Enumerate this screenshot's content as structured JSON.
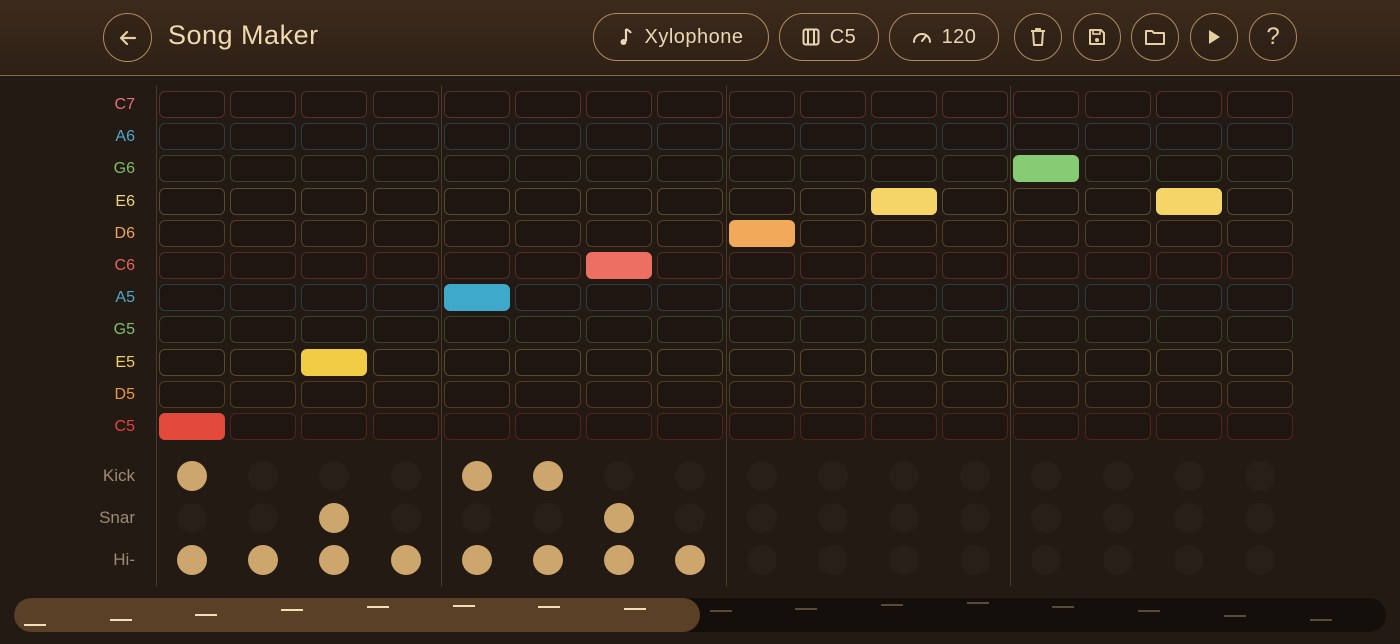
{
  "app": {
    "title": "Song Maker"
  },
  "toolbar": {
    "instrument": "Xylophone",
    "key": "C5",
    "tempo": "120",
    "icons": [
      "back-icon",
      "music-note-icon",
      "piano-icon",
      "speedometer-icon",
      "trash-icon",
      "save-icon",
      "folder-icon",
      "play-icon",
      "help-icon"
    ]
  },
  "rows": [
    {
      "label": "C7",
      "color": "#e7707e"
    },
    {
      "label": "A6",
      "color": "#4fa6c8"
    },
    {
      "label": "G6",
      "color": "#7cbf6a"
    },
    {
      "label": "E6",
      "color": "#efd47a"
    },
    {
      "label": "D6",
      "color": "#e9a55a"
    },
    {
      "label": "C6",
      "color": "#e2655a"
    },
    {
      "label": "A5",
      "color": "#4ea7c9"
    },
    {
      "label": "G5",
      "color": "#7fbf6a"
    },
    {
      "label": "E5",
      "color": "#efd064"
    },
    {
      "label": "D5",
      "color": "#e59a47"
    },
    {
      "label": "C5",
      "color": "#e3443c"
    }
  ],
  "notes": [
    {
      "row": 10,
      "col": 0,
      "color": "#e24a3c"
    },
    {
      "row": 8,
      "col": 2,
      "color": "#f2cc45"
    },
    {
      "row": 6,
      "col": 4,
      "color": "#3fa9cc"
    },
    {
      "row": 5,
      "col": 6,
      "color": "#ed6e62"
    },
    {
      "row": 4,
      "col": 8,
      "color": "#f0aa5a"
    },
    {
      "row": 3,
      "col": 10,
      "color": "#f5d568"
    },
    {
      "row": 2,
      "col": 12,
      "color": "#86cc74"
    },
    {
      "row": 3,
      "col": 14,
      "color": "#f5d568"
    }
  ],
  "drums": [
    {
      "label": "Kick",
      "hits": [
        0,
        4,
        5
      ]
    },
    {
      "label": "Snar",
      "hits": [
        2,
        6
      ]
    },
    {
      "label": "Hi-",
      "hits": [
        0,
        1,
        2,
        3,
        4,
        5,
        6,
        7
      ]
    }
  ],
  "colors": {
    "accent": "#c9a46a",
    "background": "#241a14"
  },
  "progress": {
    "fraction": 0.5
  }
}
